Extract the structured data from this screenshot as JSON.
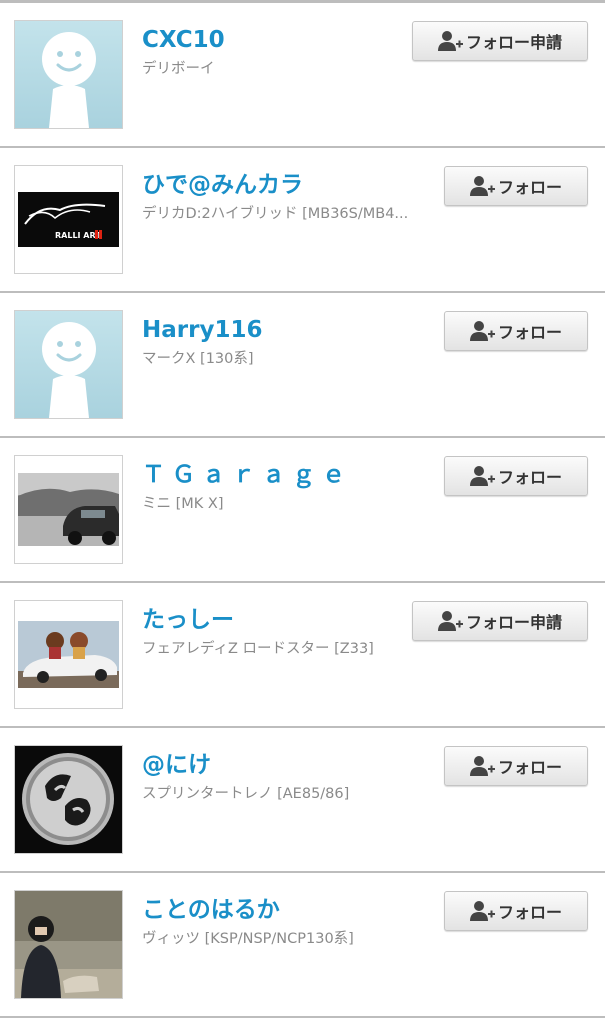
{
  "follow_icon": "add-user-icon",
  "users": [
    {
      "name": "CXC10",
      "car": "デリボーイ",
      "button": "フォロー申請",
      "avatar": "default-avatar"
    },
    {
      "name": "ひで@みんカラ",
      "car": "デリカD:2ハイブリッド [MB36S/MB4...",
      "button": "フォロー",
      "avatar": "ralliart-logo-avatar",
      "avatar_text": "RALLI ART"
    },
    {
      "name": "Harry116",
      "car": "マークX [130系]",
      "button": "フォロー",
      "avatar": "default-avatar"
    },
    {
      "name": "ＴＧａｒａｇｅ",
      "car": "ミニ [MK X]",
      "button": "フォロー",
      "avatar": "mini-car-photo-avatar"
    },
    {
      "name": "たっしー",
      "car": "フェアレディZ ロードスター [Z33]",
      "button": "フォロー申請",
      "avatar": "roadster-photo-avatar"
    },
    {
      "name": "@にけ",
      "car": "スプリンタートレノ [AE85/86]",
      "button": "フォロー",
      "avatar": "86-emblem-avatar"
    },
    {
      "name": "ことのはるか",
      "car": "ヴィッツ [KSP/NSP/NCP130系]",
      "button": "フォロー",
      "avatar": "person-photo-avatar"
    }
  ]
}
